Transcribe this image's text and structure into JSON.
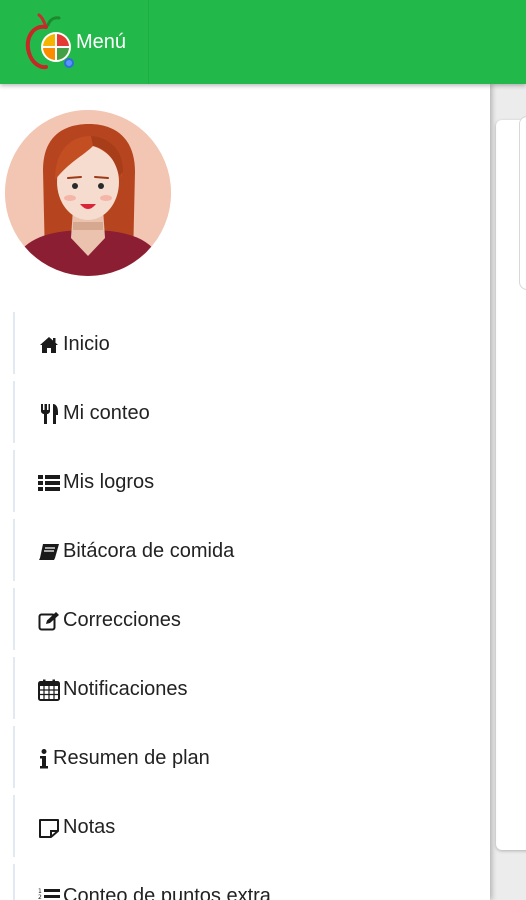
{
  "header": {
    "title": "Menú",
    "logo_icon": "apple-plate-logo-icon",
    "background": "#22b84a"
  },
  "drawer": {
    "avatar": "user-avatar-woman",
    "items": [
      {
        "label": "Inicio",
        "icon": "home-icon"
      },
      {
        "label": "Mi conteo",
        "icon": "cutlery-icon"
      },
      {
        "label": "Mis logros",
        "icon": "list-icon"
      },
      {
        "label": "Bitácora de comida",
        "icon": "book-icon"
      },
      {
        "label": "Correcciones",
        "icon": "edit-icon"
      },
      {
        "label": "Notificaciones",
        "icon": "calendar-icon"
      },
      {
        "label": "Resumen de plan",
        "icon": "info-icon"
      },
      {
        "label": "Notas",
        "icon": "sticky-note-icon"
      },
      {
        "label": "Conteo de puntos extra",
        "icon": "ordered-list-icon"
      }
    ]
  }
}
